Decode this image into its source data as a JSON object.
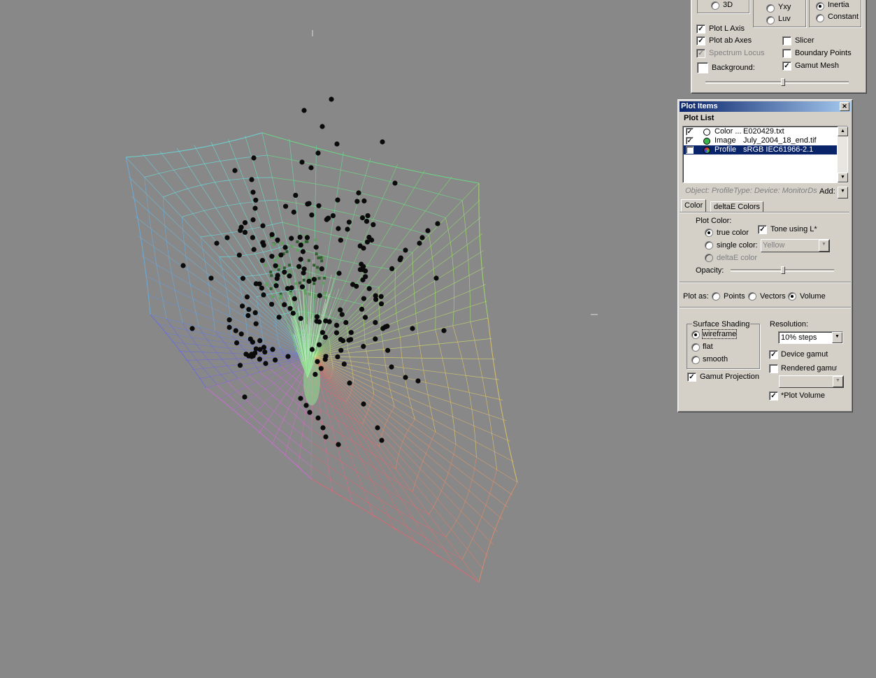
{
  "view_panel": {
    "mode_3d": "3D",
    "space_yxy": "Yxy",
    "space_luv": "Luv",
    "motion_inertia": "Inertia",
    "motion_constant": "Constant",
    "plot_l_axis": "Plot L Axis",
    "plot_ab_axes": "Plot ab Axes",
    "spectrum_locus": "Spectrum Locus",
    "background": "Background:",
    "slicer": "Slicer",
    "boundary_points": "Boundary Points",
    "gamut_mesh": "Gamut Mesh"
  },
  "plot_items": {
    "window_title": "Plot Items",
    "close_glyph": "✕",
    "plot_list_label": "Plot List",
    "rows": [
      {
        "type": "Color ...",
        "name": "E020429.txt",
        "checked": true,
        "selected": false
      },
      {
        "type": "Image",
        "name": "July_2004_18_end.tif",
        "checked": true,
        "selected": false
      },
      {
        "type": "Profile",
        "name": "sRGB IEC61966-2.1",
        "checked": true,
        "selected": true
      }
    ],
    "object_info": "Object: ProfileType: Device: MonitorDs",
    "add_label": "Add:",
    "tabs": [
      "Color",
      "deltaE Colors"
    ],
    "plot_color_label": "Plot Color:",
    "true_color": "true color",
    "single_color": "single color:",
    "single_color_value": "Yellow",
    "deltae_color": "deltaE color",
    "tone_using_l": "Tone using L*",
    "opacity_label": "Opacity:",
    "opacity_level": 0.5,
    "plot_as_label": "Plot as:",
    "points": "Points",
    "vectors": "Vectors",
    "volume": "Volume",
    "surface_shading_label": "Surface Shading",
    "wireframe": "wireframe",
    "flat": "flat",
    "smooth": "smooth",
    "gamut_projection": "Gamut Projection",
    "resolution_label": "Resolution:",
    "resolution_value": "10% steps",
    "device_gamut": "Device gamut",
    "rendered_gamut": "Rendered gamut",
    "plot_volume": "*Plot Volume",
    "check_glyph": "✓",
    "dropdown_glyph": "▼",
    "scroll_up_glyph": "▲"
  }
}
